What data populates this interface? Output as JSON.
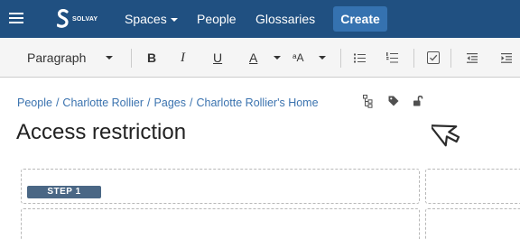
{
  "topnav": {
    "logo_text": "SOLVAY",
    "spaces_label": "Spaces",
    "people_label": "People",
    "glossaries_label": "Glossaries",
    "create_label": "Create",
    "background_color": "#205081",
    "create_color": "#3572b0"
  },
  "toolbar": {
    "paragraph_label": "Paragraph",
    "bold_label": "B",
    "italic_label": "I",
    "underline_label": "U",
    "text_color_label": "A",
    "formatting_label": "ᵃA",
    "icons": [
      "bullet-list-icon",
      "numbered-list-icon",
      "task-list-icon",
      "outdent-icon",
      "indent-icon"
    ]
  },
  "breadcrumb": {
    "items": [
      "People",
      "Charlotte Rollier",
      "Pages",
      "Charlotte Rollier's Home"
    ],
    "separator": "/",
    "icons": [
      "page-tree-icon",
      "label-tag-icon",
      "unlock-icon"
    ],
    "link_color": "#3b73af"
  },
  "page": {
    "title": "Access restriction"
  },
  "content": {
    "step_label": "STEP 1",
    "step_color": "#4a6785"
  }
}
